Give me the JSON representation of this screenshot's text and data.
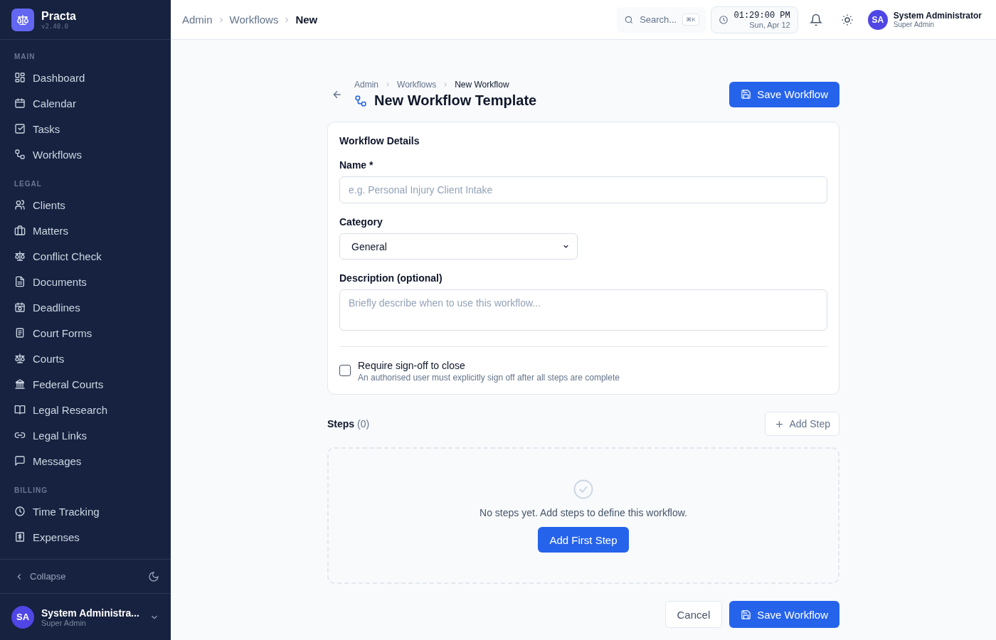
{
  "app": {
    "name": "Practa",
    "version": "v2.40.0"
  },
  "sidebar": {
    "sections": [
      {
        "title": "MAIN",
        "items": [
          {
            "label": "Dashboard"
          },
          {
            "label": "Calendar"
          },
          {
            "label": "Tasks"
          },
          {
            "label": "Workflows"
          }
        ]
      },
      {
        "title": "LEGAL",
        "items": [
          {
            "label": "Clients"
          },
          {
            "label": "Matters"
          },
          {
            "label": "Conflict Check"
          },
          {
            "label": "Documents"
          },
          {
            "label": "Deadlines"
          },
          {
            "label": "Court Forms"
          },
          {
            "label": "Courts"
          },
          {
            "label": "Federal Courts"
          },
          {
            "label": "Legal Research"
          },
          {
            "label": "Legal Links"
          },
          {
            "label": "Messages"
          }
        ]
      },
      {
        "title": "BILLING",
        "items": [
          {
            "label": "Time Tracking"
          },
          {
            "label": "Expenses"
          }
        ]
      }
    ],
    "collapse": "Collapse",
    "user": {
      "initials": "SA",
      "name": "System Administra...",
      "role": "Super Admin"
    }
  },
  "topbar": {
    "breadcrumb": [
      "Admin",
      "Workflows",
      "New"
    ],
    "search": {
      "placeholder": "Search...",
      "shortcut": "⌘K"
    },
    "time": "01:29:00 PM",
    "date": "Sun, Apr 12",
    "user": {
      "initials": "SA",
      "name": "System Administrator",
      "role": "Super Admin"
    }
  },
  "page": {
    "breadcrumb": [
      "Admin",
      "Workflows",
      "New Workflow"
    ],
    "title": "New Workflow Template",
    "save_label": "Save Workflow"
  },
  "details": {
    "heading": "Workflow Details",
    "name_label": "Name *",
    "name_placeholder": "e.g. Personal Injury Client Intake",
    "category_label": "Category",
    "category_value": "General",
    "description_label": "Description (optional)",
    "description_placeholder": "Briefly describe when to use this workflow...",
    "signoff": {
      "label": "Require sign-off to close",
      "hint": "An authorised user must explicitly sign off after all steps are complete",
      "checked": false
    }
  },
  "steps": {
    "label": "Steps",
    "count": "(0)",
    "add_label": "Add Step",
    "empty_text": "No steps yet. Add steps to define this workflow.",
    "first_label": "Add First Step"
  },
  "footer": {
    "cancel": "Cancel",
    "save": "Save Workflow"
  }
}
